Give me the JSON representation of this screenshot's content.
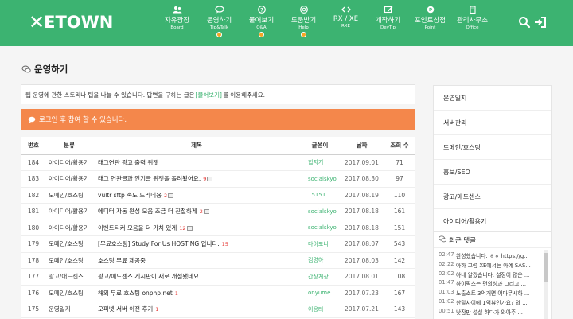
{
  "header": {
    "logo_mark": "✕",
    "logo_text": "ETOWN",
    "nav": [
      {
        "label": "자유광장",
        "sub": "Board",
        "icon": "users-icon"
      },
      {
        "label": "운영하기",
        "sub": "Tip&Talk",
        "icon": "chat-icon"
      },
      {
        "label": "물어보기",
        "sub": "Q&A",
        "icon": "question-icon"
      },
      {
        "label": "도움받기",
        "sub": "Help",
        "icon": "lifebuoy-icon"
      },
      {
        "label": "RX / XE",
        "sub": "RXE",
        "icon": "code-icon"
      },
      {
        "label": "개작하기",
        "sub": "DevTip",
        "icon": "pencil-icon"
      },
      {
        "label": "포인트상점",
        "sub": "Point",
        "icon": "coin-icon"
      },
      {
        "label": "관리사무소",
        "sub": "Office",
        "icon": "building-icon"
      }
    ]
  },
  "page": {
    "title": "운영하기",
    "intro_before": "웹 운영에 관한 스토리나 팁을 나눌 수 있습니다. 답변을 구하는 글은",
    "intro_link": "[물어보기]",
    "intro_after": "를 이용해주세요.",
    "login_notice": "로그인 후 참여 할 수 있습니다."
  },
  "table": {
    "headers": {
      "num": "번호",
      "cat": "분류",
      "subject": "제목",
      "author": "글쓴이",
      "date": "날짜",
      "views": "조회 수"
    },
    "rows": [
      {
        "num": "184",
        "cat": "아이디어/활용기",
        "subject": "태그연관 광고 출력 위젯",
        "comments": "",
        "img": false,
        "author": "힙지기",
        "date": "2017.09.01",
        "views": "71"
      },
      {
        "num": "183",
        "cat": "아이디어/활용기",
        "subject": "태그 연관글과 인기글 위젯을 돌려봤어요.",
        "comments": "9",
        "img": true,
        "author": "socialskyo",
        "date": "2017.08.30",
        "views": "97"
      },
      {
        "num": "182",
        "cat": "도메인/호스팅",
        "subject": "vultr sftp 속도 느리네용",
        "comments": "2",
        "img": true,
        "author": "15151",
        "date": "2017.08.19",
        "views": "110"
      },
      {
        "num": "181",
        "cat": "아이디어/활용기",
        "subject": "에디터 자동 완성 모음 조금 더 친절하게",
        "comments": "2",
        "img": true,
        "author": "socialskyo",
        "date": "2017.08.18",
        "views": "161"
      },
      {
        "num": "180",
        "cat": "아이디어/활용기",
        "subject": "이벤트티커 모음을 더 가치 있게",
        "comments": "12",
        "img": true,
        "author": "socialskyo",
        "date": "2017.08.18",
        "views": "151"
      },
      {
        "num": "179",
        "cat": "도메인/호스팅",
        "subject": "[무료호스팅] Study For Us HOSTING 입니다.",
        "comments": "15",
        "img": false,
        "author": "다이포니",
        "date": "2017.08.07",
        "views": "543"
      },
      {
        "num": "178",
        "cat": "도메인/호스팅",
        "subject": "호스팅 무료 제공중",
        "comments": "",
        "img": false,
        "author": "김명하",
        "date": "2017.08.03",
        "views": "142"
      },
      {
        "num": "177",
        "cat": "광고/애드센스",
        "subject": "광고/애드센스 게시판이 새로 개설됐네요",
        "comments": "",
        "img": false,
        "author": "간장게장",
        "date": "2017.08.01",
        "views": "108"
      },
      {
        "num": "176",
        "cat": "도메인/호스팅",
        "subject": "해외 무료 호스팅 onphp.net",
        "comments": "1",
        "img": false,
        "author": "onyume",
        "date": "2017.07.23",
        "views": "167"
      },
      {
        "num": "175",
        "cat": "운영일지",
        "subject": "오피넷 서버 이전 후기",
        "comments": "1",
        "img": false,
        "author": "이용터",
        "date": "2017.07.21",
        "views": "143"
      }
    ]
  },
  "sidebar": {
    "menu": [
      "운영일지",
      "서버관리",
      "도메인/호스팅",
      "홍보/SEO",
      "광고/애드센스",
      "아이디어/활용기"
    ],
    "recent_title": "최근 댓글",
    "recent": [
      {
        "time": "02:47",
        "text": "완성했습니다. ㅎㅎ https://g..."
      },
      {
        "time": "02:22",
        "text": "아하 그럼 XE에서는 아예 SAS..."
      },
      {
        "time": "02:02",
        "text": "아네 알겠습니다. 설정이 많은 ..."
      },
      {
        "time": "01:47",
        "text": "하이픽스는 편의성과 그리고 ..."
      },
      {
        "time": "01:03",
        "text": "노출소트 3억개면 어마무시하 ..."
      },
      {
        "time": "01:02",
        "text": "한달사이에 1억뷰인가요? 와 ..."
      },
      {
        "time": "00:51",
        "text": "낮잠만 설설 하다가 와아주 ..."
      }
    ]
  }
}
